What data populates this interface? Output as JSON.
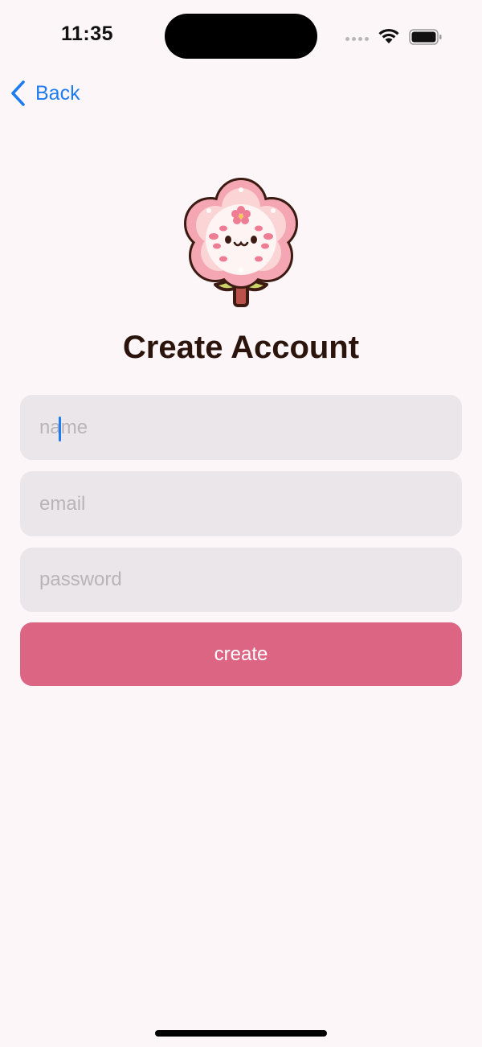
{
  "status_bar": {
    "time": "11:35",
    "icons": [
      "signal-dots-icon",
      "wifi-icon",
      "battery-icon"
    ]
  },
  "nav": {
    "back_label": "Back",
    "back_icon": "chevron-left-icon"
  },
  "logo": {
    "icon": "cherry-blossom-mascot"
  },
  "title": "Create Account",
  "form": {
    "name_placeholder": "name",
    "name_value": "",
    "email_placeholder": "email",
    "email_value": "",
    "password_placeholder": "password",
    "password_value": "",
    "submit_label": "create"
  },
  "colors": {
    "background": "#fdf6f9",
    "accent_link": "#1f7cf0",
    "button": "#dc6584",
    "field_bg": "#ebe6e9",
    "title": "#2a140c"
  }
}
